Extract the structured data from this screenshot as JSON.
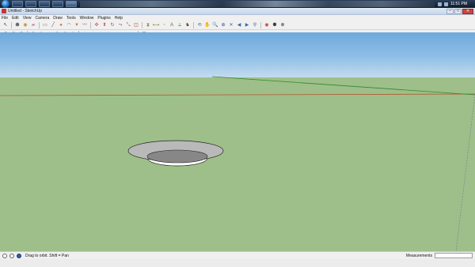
{
  "taskbar": {
    "clock": "11:51 PM"
  },
  "window": {
    "title": "Untitled - SketchUp"
  },
  "menu": [
    "File",
    "Edit",
    "View",
    "Camera",
    "Draw",
    "Tools",
    "Window",
    "Plugins",
    "Help"
  ],
  "toolbar": {
    "tools": [
      {
        "name": "select-tool-icon",
        "glyph": "↖",
        "color": "#333333"
      },
      {
        "name": "component-tool-icon",
        "glyph": "⬢",
        "color": "#6a6a6a"
      },
      {
        "name": "paint-bucket-icon",
        "glyph": "◉",
        "color": "#c98a2b"
      },
      {
        "name": "eraser-icon",
        "glyph": "▰",
        "color": "#d97aa6"
      },
      {
        "name": "rectangle-tool-icon",
        "glyph": "▭",
        "color": "#7a5a30"
      },
      {
        "name": "line-tool-icon",
        "glyph": "╱",
        "color": "#b5382c"
      },
      {
        "name": "circle-tool-icon",
        "glyph": "●",
        "color": "#c87830"
      },
      {
        "name": "arc-tool-icon",
        "glyph": "◠",
        "color": "#8a5a2a"
      },
      {
        "name": "polygon-tool-icon",
        "glyph": "▼",
        "color": "#b88b3c"
      },
      {
        "name": "freehand-tool-icon",
        "glyph": "〰",
        "color": "#a33c2a"
      },
      {
        "name": "move-tool-icon",
        "glyph": "✣",
        "color": "#c92c2c"
      },
      {
        "name": "push-pull-tool-icon",
        "glyph": "⬆",
        "color": "#c84a2a"
      },
      {
        "name": "rotate-tool-icon",
        "glyph": "↻",
        "color": "#c83a3a"
      },
      {
        "name": "follow-me-tool-icon",
        "glyph": "⤳",
        "color": "#b23a2a"
      },
      {
        "name": "scale-tool-icon",
        "glyph": "⤡",
        "color": "#b04040"
      },
      {
        "name": "offset-tool-icon",
        "glyph": "◫",
        "color": "#b8502a"
      },
      {
        "name": "tape-measure-icon",
        "glyph": "⧗",
        "color": "#8a7a2a"
      },
      {
        "name": "dimension-tool-icon",
        "glyph": "⟷",
        "color": "#7a7a2a"
      },
      {
        "name": "protractor-icon",
        "glyph": "◔",
        "color": "#c0a030"
      },
      {
        "name": "text-tool-icon",
        "glyph": "A",
        "color": "#6a6a2a"
      },
      {
        "name": "axes-tool-icon",
        "glyph": "⟂",
        "color": "#2a6a2a"
      },
      {
        "name": "3d-text-icon",
        "glyph": "♞",
        "color": "#6a4a2a"
      },
      {
        "name": "orbit-tool-icon",
        "glyph": "⟲",
        "color": "#2a5aa8"
      },
      {
        "name": "pan-tool-icon",
        "glyph": "✋",
        "color": "#3a6ab0"
      },
      {
        "name": "zoom-tool-icon",
        "glyph": "🔍",
        "color": "#2a4a8a"
      },
      {
        "name": "zoom-window-icon",
        "glyph": "⊕",
        "color": "#2a5a9a"
      },
      {
        "name": "zoom-extents-icon",
        "glyph": "✕",
        "color": "#3a6aaa"
      },
      {
        "name": "previous-view-icon",
        "glyph": "◀",
        "color": "#3a6ab0"
      },
      {
        "name": "next-view-icon",
        "glyph": "▶",
        "color": "#3a6ab0"
      },
      {
        "name": "position-camera-icon",
        "glyph": "⚲",
        "color": "#2a4a8a"
      },
      {
        "name": "look-around-icon",
        "glyph": "◉",
        "color": "#c83a3a"
      },
      {
        "name": "walk-tool-icon",
        "glyph": "⚉",
        "color": "#333333"
      },
      {
        "name": "section-plane-icon",
        "glyph": "⊗",
        "color": "#333333"
      }
    ],
    "styles": [
      {
        "name": "iso-view-icon",
        "glyph": "■",
        "color": "#1e4f8a"
      },
      {
        "name": "top-view-icon",
        "glyph": "■",
        "color": "#2c6aa8"
      },
      {
        "name": "front-view-icon",
        "glyph": "■",
        "color": "#385f86"
      },
      {
        "name": "xray-style-icon",
        "glyph": "◈",
        "color": "#2a2a2a"
      },
      {
        "name": "wireframe-style-icon",
        "glyph": "◆",
        "color": "#c8a020"
      },
      {
        "name": "hidden-line-style-icon",
        "glyph": "▲",
        "color": "#c8a020"
      },
      {
        "name": "shaded-style-icon",
        "glyph": "◆",
        "color": "#6a6a6a"
      },
      {
        "name": "textured-style-icon",
        "glyph": "◆",
        "color": "#9a7a4a"
      },
      {
        "name": "monochrome-style-icon",
        "glyph": "◆",
        "color": "#a0a0a0"
      },
      {
        "name": "house-iso-icon",
        "glyph": "⌂",
        "color": "#333333"
      },
      {
        "name": "house-top-icon",
        "glyph": "⌂",
        "color": "#333333"
      },
      {
        "name": "house-front-icon",
        "glyph": "⌂",
        "color": "#333333"
      },
      {
        "name": "house-right-icon",
        "glyph": "⌂",
        "color": "#333333"
      },
      {
        "name": "house-back-icon",
        "glyph": "⌂",
        "color": "#333333"
      },
      {
        "name": "house-left-icon",
        "glyph": "⌂",
        "color": "#333333"
      },
      {
        "name": "house-outline-icon",
        "glyph": "⌂",
        "color": "#555555"
      },
      {
        "name": "view-box-icon",
        "glyph": "▢",
        "color": "#555555"
      }
    ]
  },
  "viewport": {
    "sky_color": "#8fbfe6",
    "ground_color": "#9ebf89"
  },
  "status": {
    "message": "Drag to orbit.  Shift = Pan",
    "measurements_label": "Measurements",
    "measurements_value": ""
  }
}
